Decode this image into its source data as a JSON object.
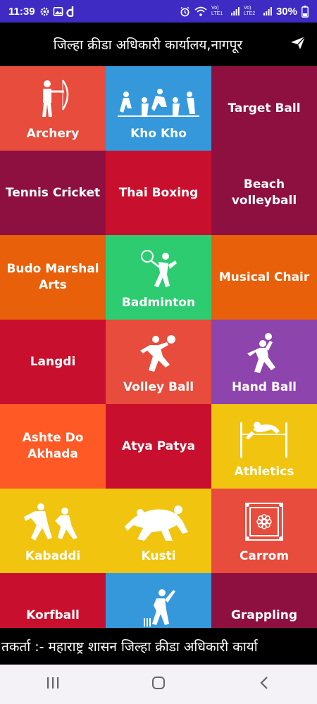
{
  "status": {
    "time": "11:39",
    "battery": "30%",
    "sim1": "Vo) LTE1",
    "sim2": "Vo) LTE2",
    "icons": [
      "settings-icon",
      "image-icon",
      "d-app-icon",
      "alarm-icon",
      "wifi-icon",
      "signal-icon",
      "battery-icon"
    ]
  },
  "app_bar": {
    "title": "जिल्हा क्रीडा अधिकारी कार्यालय,नागपूर",
    "action_icon": "send-icon"
  },
  "tiles": [
    {
      "label": "Archery",
      "color": "#e74c3c",
      "icon": "archer-icon"
    },
    {
      "label": "Kho Kho",
      "color": "#3498db",
      "icon": "kho-kho-icon"
    },
    {
      "label": "Target Ball",
      "color": "#8e1040",
      "icon": ""
    },
    {
      "label": "Tennis Cricket",
      "color": "#8e1040",
      "icon": ""
    },
    {
      "label": "Thai Boxing",
      "color": "#c8102e",
      "icon": ""
    },
    {
      "label": "Beach volleyball",
      "color": "#8e1040",
      "icon": ""
    },
    {
      "label": "Budo Marshal Arts",
      "color": "#e8600a",
      "icon": ""
    },
    {
      "label": "Badminton",
      "color": "#2ecc71",
      "icon": "badminton-icon"
    },
    {
      "label": "Musical Chair",
      "color": "#e8600a",
      "icon": ""
    },
    {
      "label": "Langdi",
      "color": "#c8102e",
      "icon": ""
    },
    {
      "label": "Volley Ball",
      "color": "#e74c3c",
      "icon": "volleyball-icon"
    },
    {
      "label": "Hand Ball",
      "color": "#8e44ad",
      "icon": "handball-icon"
    },
    {
      "label": "Ashte Do Akhada",
      "color": "#ff5a26",
      "icon": ""
    },
    {
      "label": "Atya Patya",
      "color": "#c8102e",
      "icon": ""
    },
    {
      "label": "Athletics",
      "color": "#f1c40f",
      "icon": "high-jump-icon"
    },
    {
      "label": "Kabaddi",
      "color": "#f1c40f",
      "icon": "kabaddi-icon"
    },
    {
      "label": "Kusti",
      "color": "#f1c40f",
      "icon": "wrestling-icon"
    },
    {
      "label": "Carrom",
      "color": "#e74c3c",
      "icon": "carrom-icon"
    },
    {
      "label": "Korfball",
      "color": "#c8102e",
      "icon": ""
    },
    {
      "label": "",
      "color": "#3498db",
      "icon": "cricket-icon"
    },
    {
      "label": "Grappling",
      "color": "#8e1040",
      "icon": ""
    }
  ],
  "ticker": {
    "text": "तकर्ता :- महाराष्ट्र शासन जिल्हा क्रीडा अधिकारी कार्या"
  },
  "nav": {
    "icons": [
      "recent-apps-icon",
      "home-icon",
      "back-icon"
    ]
  }
}
